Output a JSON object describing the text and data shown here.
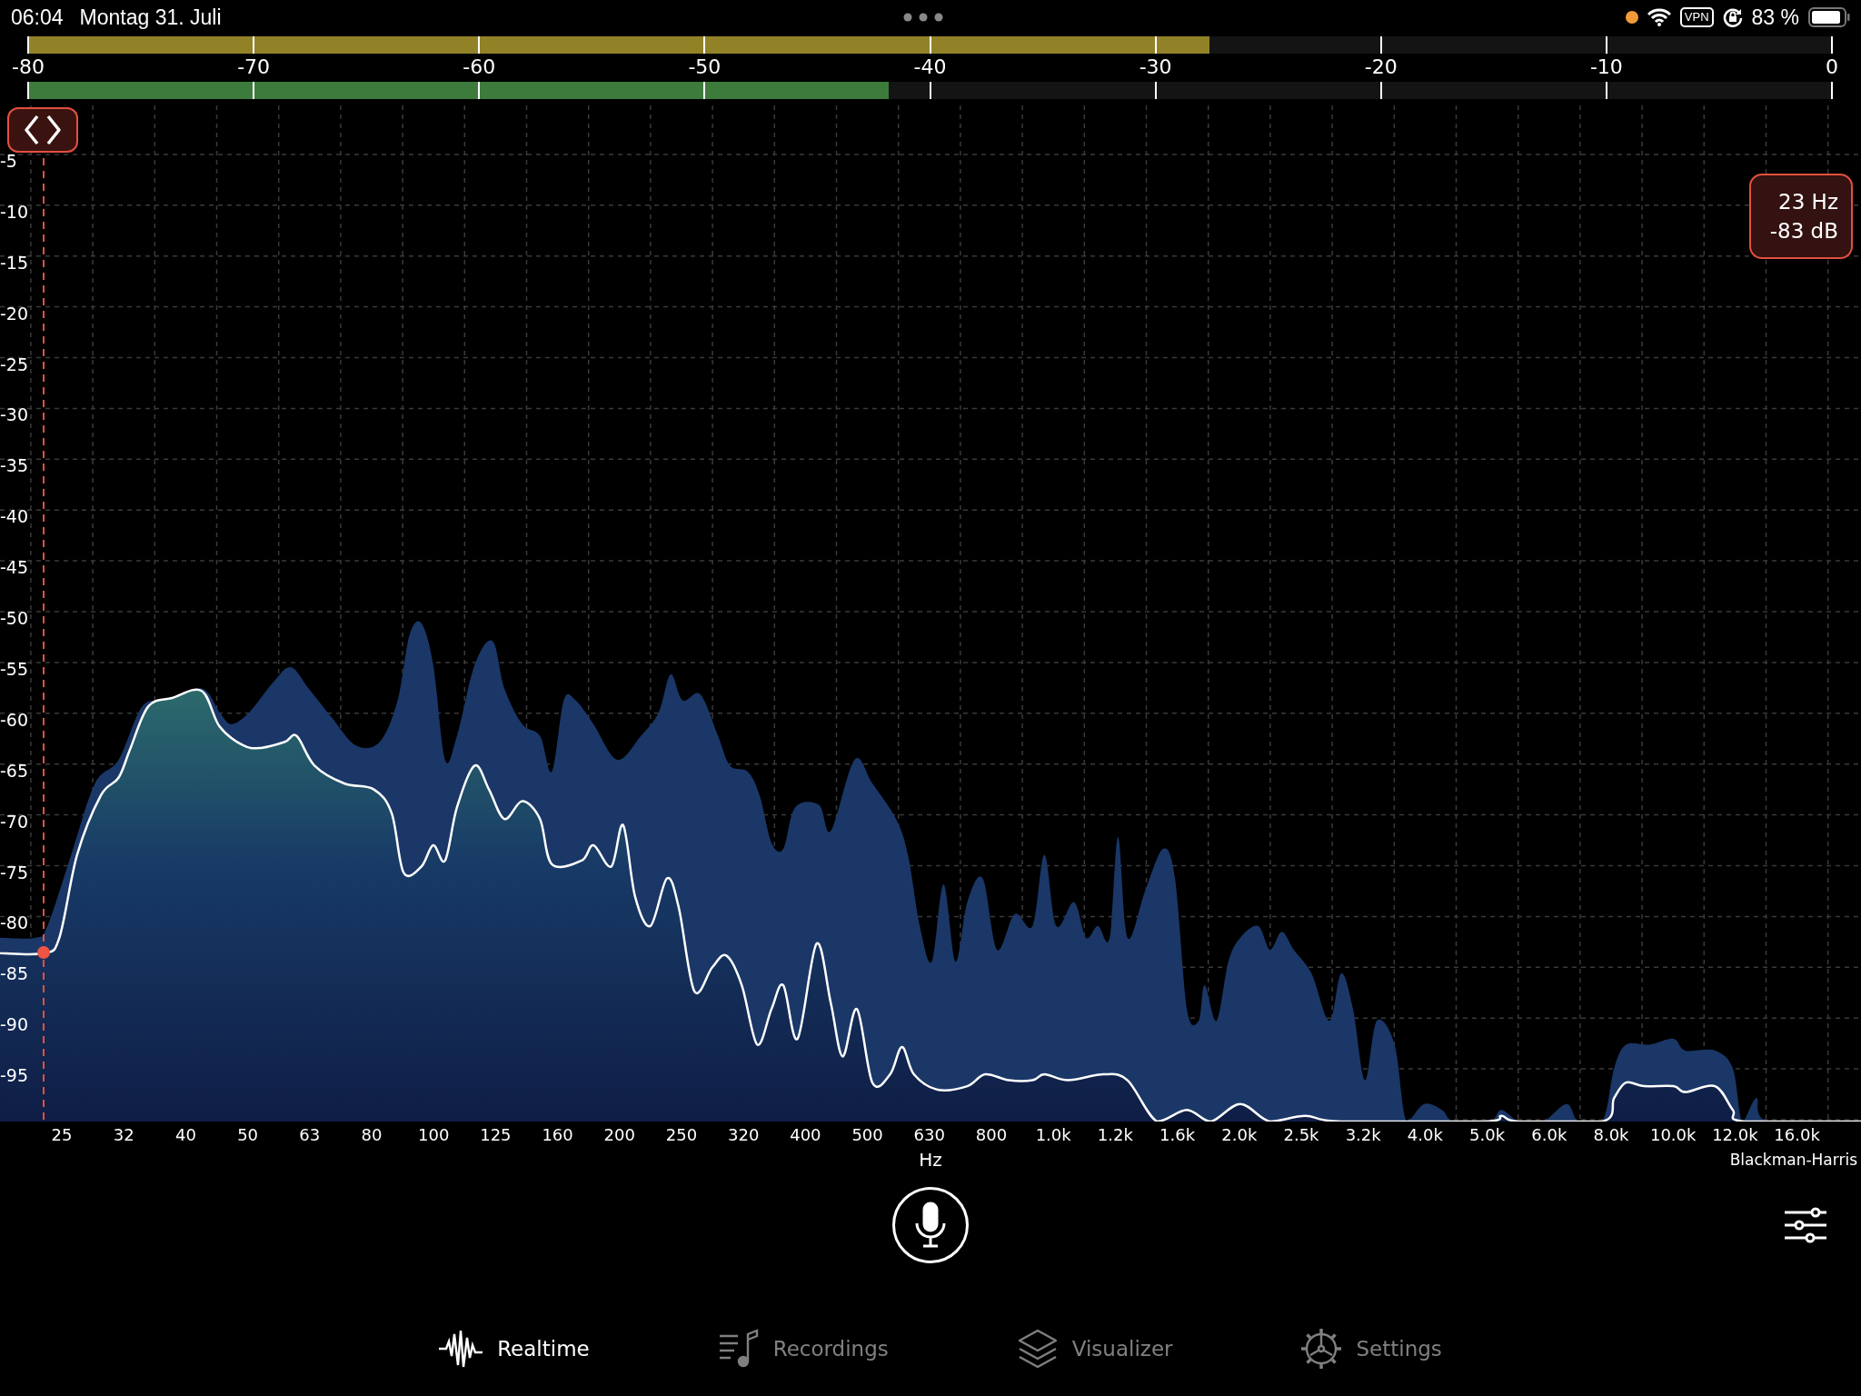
{
  "status_bar": {
    "time": "06:04",
    "date": "Montag 31. Juli",
    "vpn": "VPN",
    "battery": "83 %"
  },
  "level_meter": {
    "peak": {
      "level": 0.655
    },
    "rms": {
      "level": 0.477
    },
    "scale": [
      "-80",
      "-70",
      "-60",
      "-50",
      "-40",
      "-30",
      "-20",
      "-10",
      "0"
    ]
  },
  "spectrum": {
    "readout": {
      "frequency": "23 Hz",
      "amplitude": "-83 dB"
    },
    "y_axis": [
      "-5",
      "-10",
      "-15",
      "-20",
      "-25",
      "-30",
      "-35",
      "-40",
      "-45",
      "-50",
      "-55",
      "-60",
      "-65",
      "-70",
      "-75",
      "-80",
      "-85",
      "-90",
      "-95"
    ],
    "x_axis": [
      "25",
      "32",
      "40",
      "50",
      "63",
      "80",
      "100",
      "125",
      "160",
      "200",
      "250",
      "320",
      "400",
      "500",
      "630",
      "800",
      "1.0k",
      "1.2k",
      "1.6k",
      "2.0k",
      "2.5k",
      "3.2k",
      "4.0k",
      "5.0k",
      "6.0k",
      "8.0k",
      "10.0k",
      "12.0k",
      "16.0k"
    ],
    "x_unit": "Hz",
    "window_function": "Blackman-Harris"
  },
  "tabs": [
    {
      "kind": "waveform",
      "label": "Realtime",
      "selected": true
    },
    {
      "kind": "recordings",
      "label": "Recordings",
      "selected": false
    },
    {
      "kind": "layers",
      "label": "Visualizer",
      "selected": false
    },
    {
      "kind": "gear",
      "label": "Settings",
      "selected": false
    }
  ]
}
